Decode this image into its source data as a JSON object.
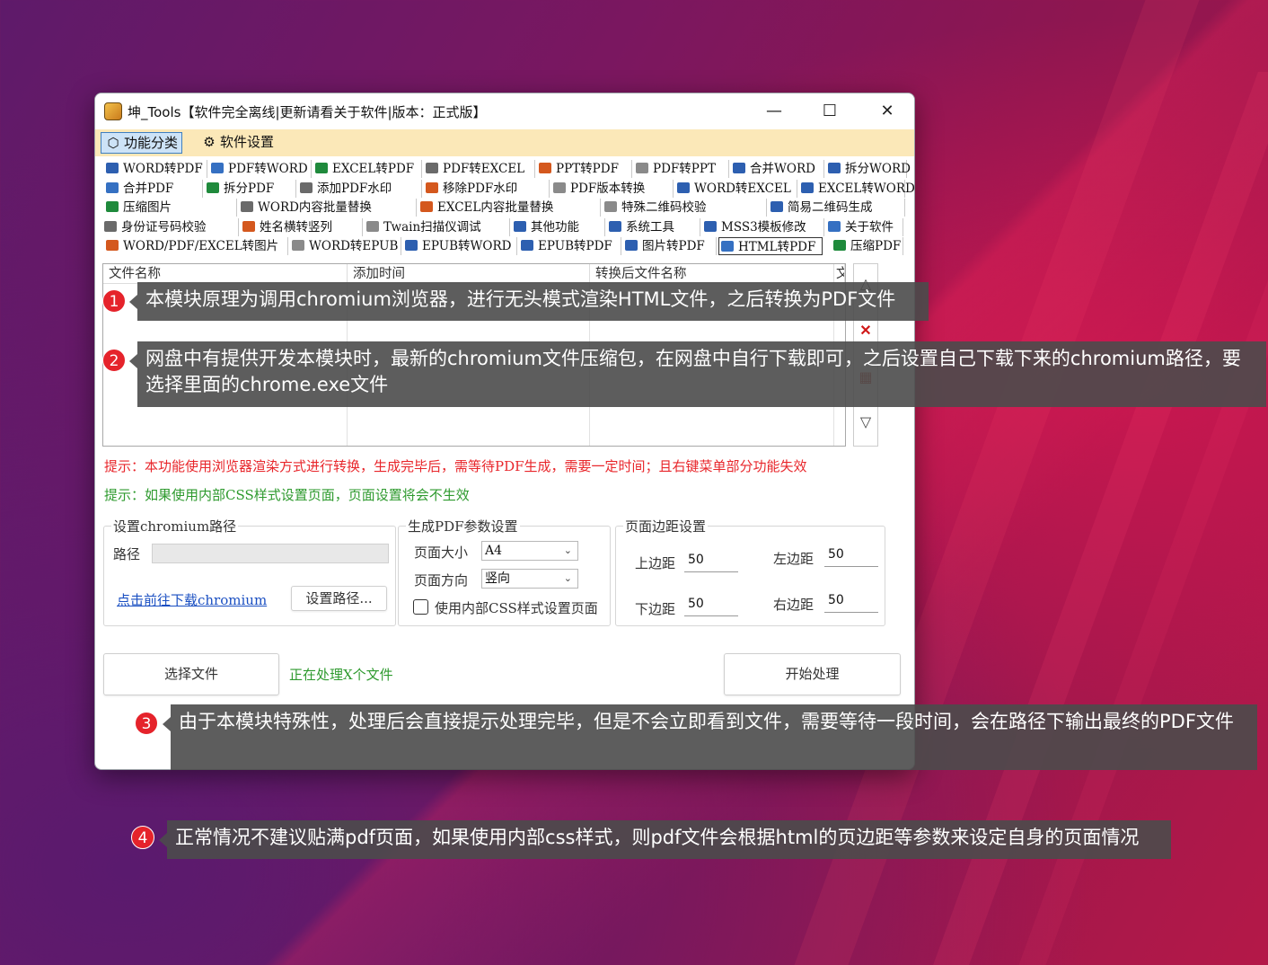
{
  "window": {
    "title": "坤_Tools【软件完全离线|更新请看关于软件|版本：正式版】"
  },
  "menu": {
    "items": [
      {
        "label": "功能分类"
      },
      {
        "label": "软件设置"
      }
    ]
  },
  "tabs": [
    [
      "WORD转PDF",
      "PDF转WORD",
      "EXCEL转PDF",
      "PDF转EXCEL",
      "PPT转PDF",
      "PDF转PPT",
      "合并WORD",
      "拆分WORD"
    ],
    [
      "合并PDF",
      "拆分PDF",
      "添加PDF水印",
      "移除PDF水印",
      "PDF版本转换",
      "WORD转EXCEL",
      "EXCEL转WORD"
    ],
    [
      "压缩图片",
      "WORD内容批量替换",
      "EXCEL内容批量替换",
      "特殊二维码校验",
      "简易二维码生成"
    ],
    [
      "身份证号码校验",
      "姓名横转竖列",
      "Twain扫描仪调试",
      "其他功能",
      "系统工具",
      "MSS3模板修改",
      "关于软件"
    ],
    [
      "WORD/PDF/EXCEL转图片",
      "WORD转EPUB",
      "EPUB转WORD",
      "EPUB转PDF",
      "图片转PDF",
      "HTML转PDF",
      "压缩PDF"
    ]
  ],
  "selected_tab": "HTML转PDF",
  "list": {
    "columns": [
      "文件名称",
      "添加时间",
      "转换后文件名称",
      "文"
    ]
  },
  "hints": {
    "red": "提示：本功能使用浏览器渲染方式进行转换，生成完毕后，需等待PDF生成，需要一定时间；且右键菜单部分功能失效",
    "green": "提示：如果使用内部CSS样式设置页面，页面设置将会不生效"
  },
  "chromium_group": {
    "title": "设置chromium路径",
    "path_label": "路径",
    "download_link": "点击前往下载chromium",
    "set_button": "设置路径..."
  },
  "pdf_group": {
    "title": "生成PDF参数设置",
    "size_label": "页面大小",
    "size_value": "A4",
    "orient_label": "页面方向",
    "orient_value": "竖向",
    "css_checkbox": "使用内部CSS样式设置页面"
  },
  "margin_group": {
    "title": "页面边距设置",
    "top_label": "上边距",
    "top_value": "50",
    "left_label": "左边距",
    "left_value": "50",
    "bottom_label": "下边距",
    "bottom_value": "50",
    "right_label": "右边距",
    "right_value": "50"
  },
  "actions": {
    "select_files": "选择文件",
    "status": "正在处理X个文件",
    "start": "开始处理"
  },
  "callouts": [
    {
      "num": "1",
      "text": "本模块原理为调用chromium浏览器，进行无头模式渲染HTML文件，之后转换为PDF文件"
    },
    {
      "num": "2",
      "text": "网盘中有提供开发本模块时，最新的chromium文件压缩包，在网盘中自行下载即可，之后设置自己下载下来的chromium路径，要选择里面的chrome.exe文件"
    },
    {
      "num": "3",
      "text": "由于本模块特殊性，处理后会直接提示处理完毕，但是不会立即看到文件，需要等待一段时间，会在路径下输出最终的PDF文件"
    },
    {
      "num": "4",
      "text": "正常情况不建议贴满pdf页面，如果使用内部css样式，则pdf文件会根据html的页边距等参数来设定自身的页面情况"
    }
  ],
  "colors": {
    "hint_red": "#e8262b",
    "hint_green": "#2e9a2e",
    "menubar": "#fbe8b8",
    "callout_bg": "#4b4b4b",
    "badge": "#e5232b"
  }
}
